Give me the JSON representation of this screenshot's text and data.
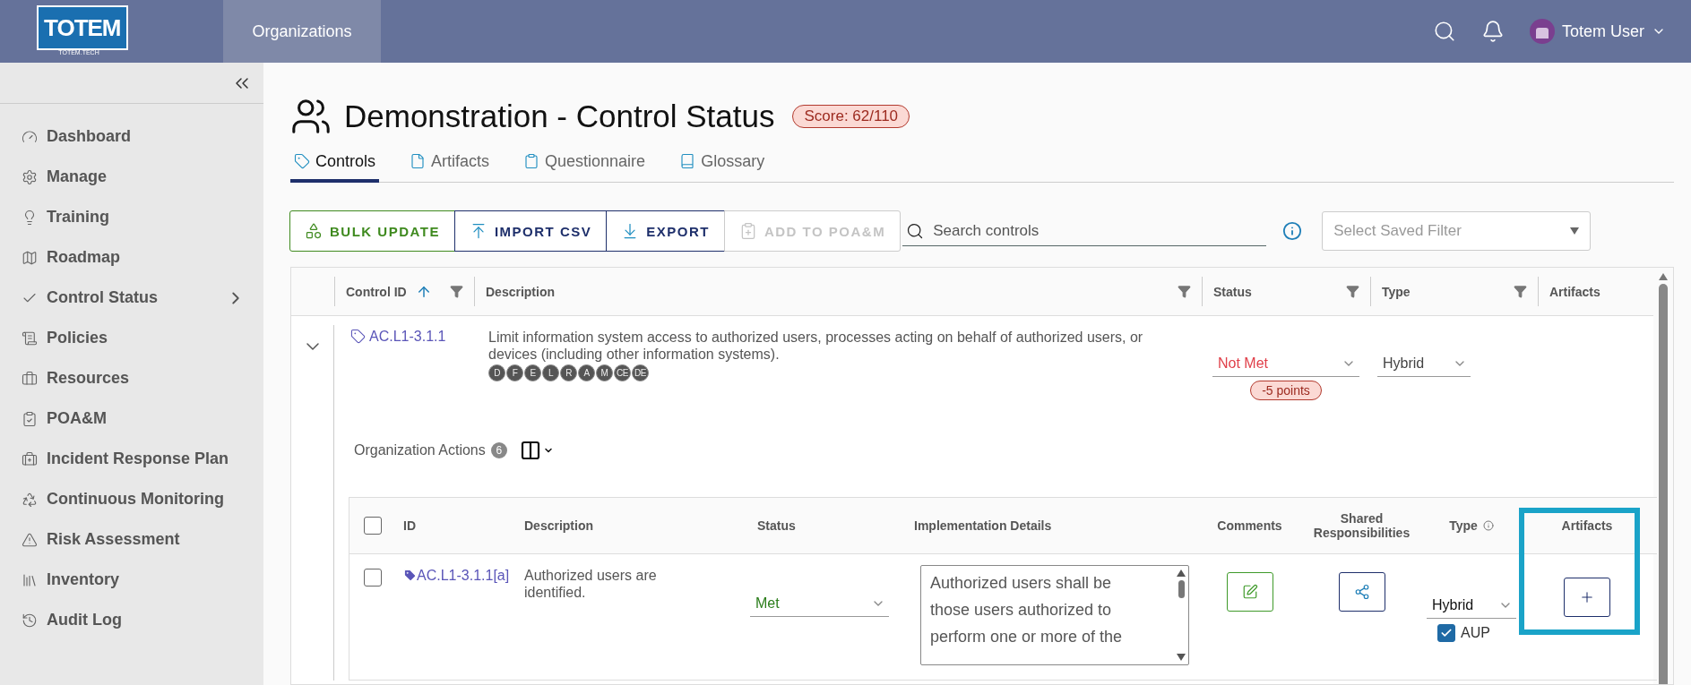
{
  "header": {
    "logo": "TOTEM",
    "logo_subtitle": "TOTEM.TECH",
    "nav": [
      {
        "label": "Organizations",
        "selected": true
      }
    ],
    "user": "Totem User"
  },
  "sidebar": {
    "items": [
      {
        "label": "Dashboard",
        "has_submenu": false
      },
      {
        "label": "Manage",
        "has_submenu": false
      },
      {
        "label": "Training",
        "has_submenu": false
      },
      {
        "label": "Roadmap",
        "has_submenu": false
      },
      {
        "label": "Control Status",
        "has_submenu": true
      },
      {
        "label": "Policies",
        "has_submenu": false
      },
      {
        "label": "Resources",
        "has_submenu": false
      },
      {
        "label": "POA&M",
        "has_submenu": false
      },
      {
        "label": "Incident Response Plan",
        "has_submenu": false
      },
      {
        "label": "Continuous Monitoring",
        "has_submenu": false
      },
      {
        "label": "Risk Assessment",
        "has_submenu": false
      },
      {
        "label": "Inventory",
        "has_submenu": false
      },
      {
        "label": "Audit Log",
        "has_submenu": false
      }
    ]
  },
  "page": {
    "title": "Demonstration - Control Status",
    "score": "Score: 62/110",
    "tabs": [
      {
        "label": "Controls",
        "selected": true
      },
      {
        "label": "Artifacts",
        "selected": false
      },
      {
        "label": "Questionnaire",
        "selected": false
      },
      {
        "label": "Glossary",
        "selected": false
      }
    ],
    "toolbar": {
      "buttons": [
        {
          "label": "BULK UPDATE",
          "kind": "bulk",
          "disabled": false
        },
        {
          "label": "IMPORT CSV",
          "kind": "import",
          "disabled": false
        },
        {
          "label": "EXPORT",
          "kind": "export",
          "disabled": false
        },
        {
          "label": "ADD TO POA&M",
          "kind": "poam",
          "disabled": true
        }
      ],
      "search": {
        "placeholder": "Search controls"
      },
      "saved_filter": {
        "placeholder": "Select Saved Filter"
      }
    }
  },
  "table": {
    "columns": [
      {
        "label": "Control ID",
        "sorted": true,
        "filter": true
      },
      {
        "label": "Description",
        "sorted": false,
        "filter": true
      },
      {
        "label": "Status",
        "sorted": false,
        "filter": true
      },
      {
        "label": "Type",
        "sorted": false,
        "filter": true
      },
      {
        "label": "Artifacts",
        "sorted": false,
        "filter": false
      }
    ],
    "rows": [
      {
        "expanded": true,
        "id": "AC.L1-3.1.1",
        "description": "Limit information system access to authorized users, processes acting on behalf of authorized users, or devices (including other information systems).",
        "tags": [
          "D",
          "F",
          "E",
          "L",
          "R",
          "A",
          "M",
          "CE",
          "DE"
        ],
        "status": {
          "label": "Not Met",
          "color": "#e0404a"
        },
        "points": "-5 points",
        "type": "Hybrid",
        "actions": {
          "label": "Organization Actions",
          "count": "6",
          "select_all": false,
          "columns": [
            {
              "label": "ID",
              "info": false
            },
            {
              "label": "Description",
              "info": false
            },
            {
              "label": "Status",
              "info": false
            },
            {
              "label": "Implementation Details",
              "info": false
            },
            {
              "label": "Comments",
              "info": false
            },
            {
              "label": "Shared Responsibilities",
              "info": false
            },
            {
              "label": "Type",
              "info": true
            },
            {
              "label": "Artifacts",
              "info": false
            }
          ],
          "rows": [
            {
              "checked": false,
              "id": "AC.L1-3.1.1[a]",
              "description": "Authorized users are identified.",
              "status": {
                "label": "Met",
                "color": "#2a7d1a"
              },
              "implementation": "Authorized users shall be those users authorized to perform one or more of the",
              "type": "Hybrid",
              "aup": {
                "label": "AUP",
                "checked": true
              }
            }
          ]
        }
      }
    ]
  }
}
